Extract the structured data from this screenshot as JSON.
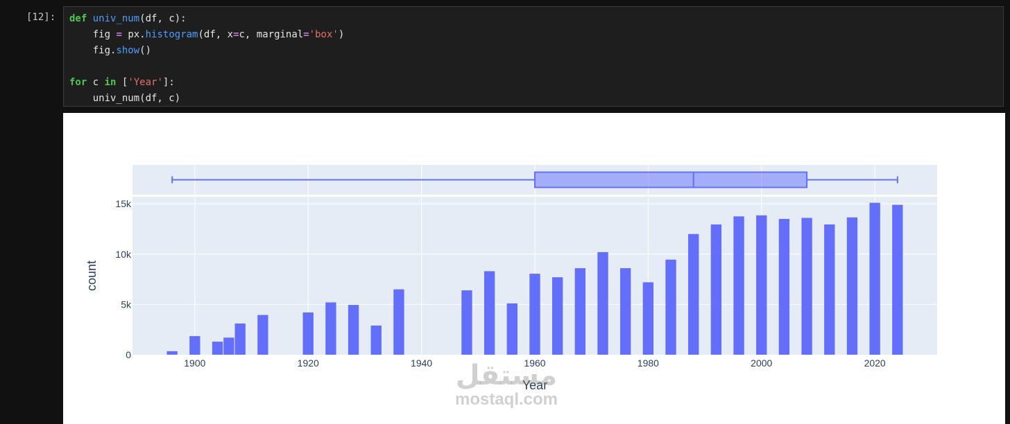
{
  "cell": {
    "prompt": "[12]:",
    "code": {
      "l1": {
        "def": "def",
        "fname": "univ_num",
        "args": "(df, c):"
      },
      "l2": {
        "indent": "    ",
        "fig": "fig",
        "eq": "=",
        "px": "px.",
        "hist": "histogram",
        "a1": "(df, x",
        "eq2": "=",
        "a2": "c, marginal",
        "eq3": "=",
        "s": "'box'",
        "close": ")"
      },
      "l3": {
        "indent": "    ",
        "fig": "fig.",
        "show": "show",
        "paren": "()"
      },
      "l5": {
        "for": "for",
        "c": " c ",
        "in": "in",
        "sp": " ",
        "lb": "[",
        "s": "'Year'",
        "rb": "]",
        "colon": ":"
      },
      "l6": {
        "indent": "    ",
        "call": "univ_num(df, c)"
      }
    }
  },
  "chart_data": {
    "type": "bar",
    "marginal": "box",
    "xlabel": "Year",
    "ylabel": "count",
    "xlim": [
      1889,
      2031
    ],
    "ylim": [
      0,
      15700
    ],
    "grid": true,
    "bar_color": "#636efa",
    "plot_bg": "#e5ecf6",
    "x_ticks": [
      1900,
      1920,
      1940,
      1960,
      1980,
      2000,
      2020
    ],
    "y_ticks": [
      {
        "value": 0,
        "label": "0"
      },
      {
        "value": 5000,
        "label": "5k"
      },
      {
        "value": 10000,
        "label": "10k"
      },
      {
        "value": 15000,
        "label": "15k"
      }
    ],
    "bins": [
      {
        "x0": 1895,
        "x1": 1897,
        "count": 350
      },
      {
        "x0": 1899,
        "x1": 1901,
        "count": 1850
      },
      {
        "x0": 1903,
        "x1": 1905,
        "count": 1300
      },
      {
        "x0": 1905,
        "x1": 1907,
        "count": 1700
      },
      {
        "x0": 1907,
        "x1": 1909,
        "count": 3100
      },
      {
        "x0": 1911,
        "x1": 1913,
        "count": 3950
      },
      {
        "x0": 1919,
        "x1": 1921,
        "count": 4200
      },
      {
        "x0": 1923,
        "x1": 1925,
        "count": 5200
      },
      {
        "x0": 1927,
        "x1": 1929,
        "count": 4950
      },
      {
        "x0": 1931,
        "x1": 1933,
        "count": 2900
      },
      {
        "x0": 1935,
        "x1": 1937,
        "count": 6500
      },
      {
        "x0": 1947,
        "x1": 1949,
        "count": 6400
      },
      {
        "x0": 1951,
        "x1": 1953,
        "count": 8300
      },
      {
        "x0": 1955,
        "x1": 1957,
        "count": 5100
      },
      {
        "x0": 1959,
        "x1": 1961,
        "count": 8050
      },
      {
        "x0": 1963,
        "x1": 1965,
        "count": 7700
      },
      {
        "x0": 1967,
        "x1": 1969,
        "count": 8600
      },
      {
        "x0": 1971,
        "x1": 1973,
        "count": 10200
      },
      {
        "x0": 1975,
        "x1": 1977,
        "count": 8600
      },
      {
        "x0": 1979,
        "x1": 1981,
        "count": 7200
      },
      {
        "x0": 1983,
        "x1": 1985,
        "count": 9450
      },
      {
        "x0": 1987,
        "x1": 1989,
        "count": 12000
      },
      {
        "x0": 1991,
        "x1": 1993,
        "count": 12950
      },
      {
        "x0": 1995,
        "x1": 1997,
        "count": 13750
      },
      {
        "x0": 1999,
        "x1": 2001,
        "count": 13850
      },
      {
        "x0": 2003,
        "x1": 2005,
        "count": 13500
      },
      {
        "x0": 2007,
        "x1": 2009,
        "count": 13600
      },
      {
        "x0": 2011,
        "x1": 2013,
        "count": 12950
      },
      {
        "x0": 2015,
        "x1": 2017,
        "count": 13650
      },
      {
        "x0": 2019,
        "x1": 2021,
        "count": 15100
      },
      {
        "x0": 2023,
        "x1": 2025,
        "count": 14900
      }
    ],
    "box": {
      "lower_fence": 1896,
      "q1": 1960,
      "median": 1988,
      "q3": 2008,
      "upper_fence": 2024
    }
  },
  "watermark": {
    "logo": "مستقل",
    "url": "mostaql.com"
  }
}
